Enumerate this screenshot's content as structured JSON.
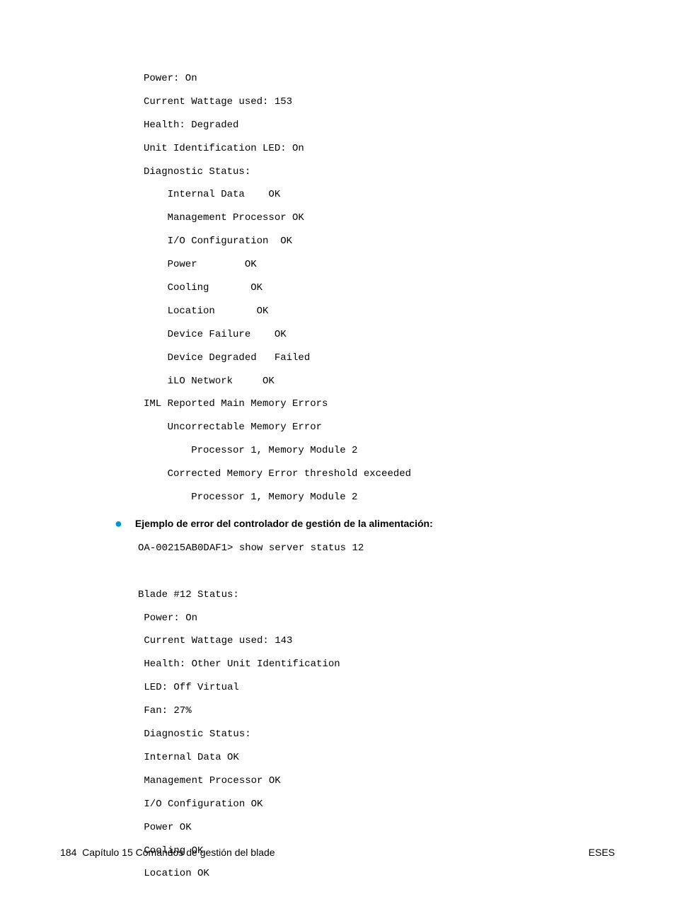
{
  "block1": "Power: On\nCurrent Wattage used: 153\nHealth: Degraded\nUnit Identification LED: On\nDiagnostic Status:\n    Internal Data    OK\n    Management Processor OK\n    I/O Configuration  OK\n    Power        OK\n    Cooling       OK\n    Location       OK\n    Device Failure    OK\n    Device Degraded   Failed\n    iLO Network     OK\nIML Reported Main Memory Errors\n    Uncorrectable Memory Error\n        Processor 1, Memory Module 2\n    Corrected Memory Error threshold exceeded\n        Processor 1, Memory Module 2",
  "bullet": {
    "label": "Ejemplo de error del controlador de gestión de la alimentación:"
  },
  "block2": "OA-00215AB0DAF1> show server status 12\n\nBlade #12 Status:\n Power: On\n Current Wattage used: 143\n Health: Other Unit Identification\n LED: Off Virtual\n Fan: 27%\n Diagnostic Status:\n Internal Data OK\n Management Processor OK\n I/O Configuration OK\n Power OK\n Cooling OK\n Location OK",
  "footer": {
    "page_number": "184",
    "chapter": "Capítulo 15   Comandos de gestión del blade",
    "right": "ESES"
  }
}
